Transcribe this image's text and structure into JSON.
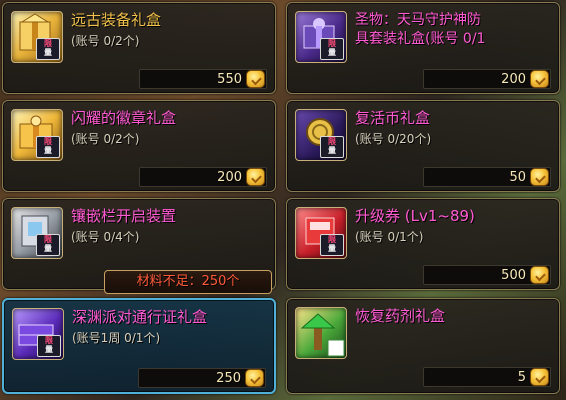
{
  "items": [
    {
      "title": "远古装备礼盒",
      "sub": "(账号 0/2个)",
      "price": "550",
      "icon": "golden-box-icon",
      "badge": [
        "限",
        "量"
      ]
    },
    {
      "title_line1": "圣物：天马守护神防",
      "title_line2": "具套装礼盒(账号 0/1",
      "price": "200",
      "icon": "purple-box-icon",
      "badge": [
        "限",
        "量"
      ]
    },
    {
      "title": "闪耀的徽章礼盒",
      "sub": "(账号 0/2个)",
      "price": "200",
      "icon": "golden-box-icon",
      "badge": [
        "限",
        "量"
      ]
    },
    {
      "title": "复活币礼盒",
      "sub": "(账号 0/20个)",
      "price": "50",
      "icon": "coin-box-icon",
      "badge": [
        "限",
        "量"
      ]
    },
    {
      "title": "镶嵌栏开启装置",
      "sub": "(账号 0/4个)",
      "price": "",
      "icon": "socket-device-icon",
      "badge": [
        "限",
        "量"
      ]
    },
    {
      "title": "升级券 (Lv1~89)",
      "sub": "(账号 0/1个)",
      "price": "500",
      "icon": "level-ticket-icon",
      "badge": [
        "限",
        "量"
      ]
    },
    {
      "title": "深渊派对通行证礼盒",
      "sub": "(账号1周 0/1个)",
      "price": "250",
      "icon": "abyss-pass-box-icon",
      "badge": [
        "限",
        "量"
      ]
    },
    {
      "title": "恢复药剂礼盒",
      "sub": "",
      "price": "5",
      "icon": "potion-box-icon",
      "badge": []
    }
  ],
  "tooltip": "材料不足：250个",
  "colors": {
    "title_gold": "#f2c24a",
    "title_pink": "#ff5ad2",
    "selected_border": "#4fb0d8",
    "tooltip_text": "#ff5a3a"
  }
}
